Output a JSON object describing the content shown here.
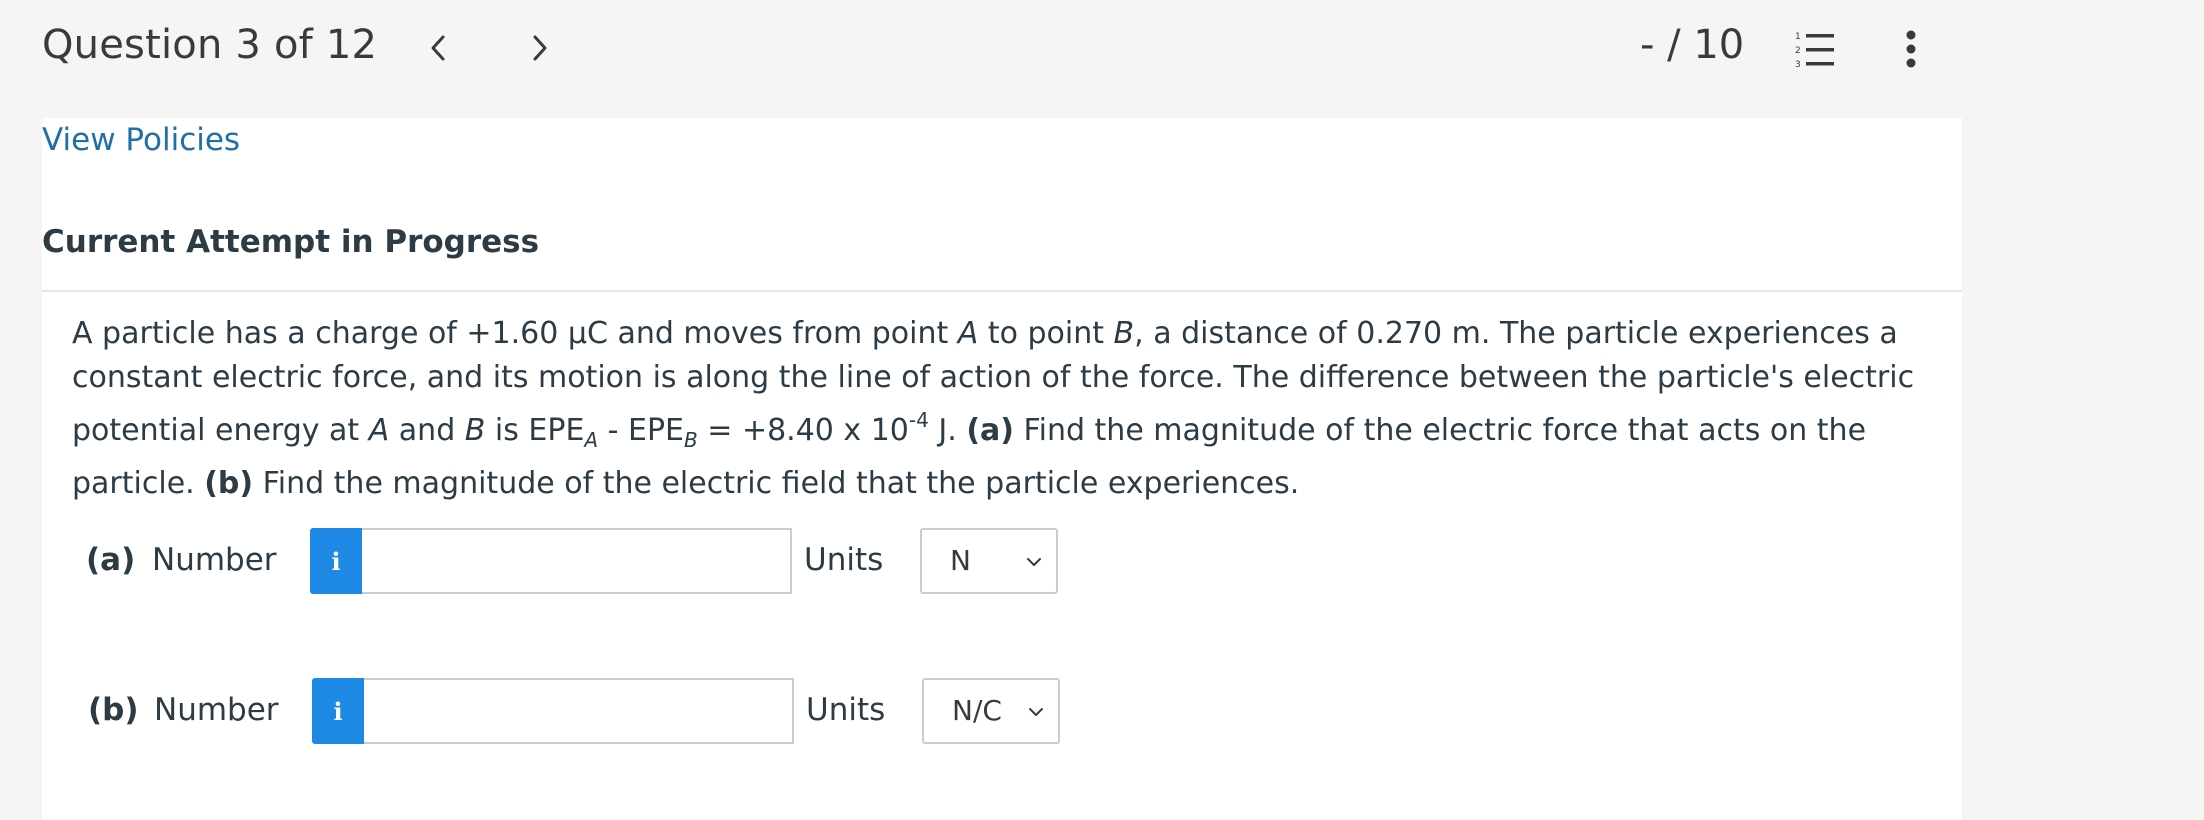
{
  "header": {
    "question_label": "Question 3 of 12",
    "score": "- / 10"
  },
  "policies_link": "View Policies",
  "attempt_heading": "Current Attempt in Progress",
  "question": {
    "text_1": "A particle has a charge of +1.60 μC and moves from point ",
    "point_a": "A",
    "text_2": " to point ",
    "point_b": "B",
    "text_3": ", a distance of 0.270 m. The particle experiences a constant electric force, and its motion is along the line of action of the force. The difference between the particle's electric potential energy at ",
    "point_a2": "A",
    "text_4": " and ",
    "point_b2": "B",
    "text_5": " is EPE",
    "sub_a": "A",
    "text_6": " - EPE",
    "sub_b": "B",
    "text_7": " = +8.40 x 10",
    "exponent": "-4",
    "text_8": " J. ",
    "part_a_bold": "(a)",
    "text_9": " Find the magnitude of the electric force that acts on the particle. ",
    "part_b_bold": "(b)",
    "text_10": " Find the magnitude of the electric field that the particle experiences."
  },
  "answers": [
    {
      "part": "(a)",
      "number_label": "Number",
      "info_icon": "i",
      "value": "",
      "units_label": "Units",
      "unit": "N"
    },
    {
      "part": "(b)",
      "number_label": "Number",
      "info_icon": "i",
      "value": "",
      "units_label": "Units",
      "unit": "N/C"
    }
  ],
  "icons": {
    "prev": "chevron-left-icon",
    "next": "chevron-right-icon",
    "list": "numbered-list-icon",
    "more": "more-vertical-icon",
    "info": "info-icon",
    "dropdown": "chevron-down-icon"
  },
  "colors": {
    "link": "#1f6fa8",
    "info_button": "#1e88e5",
    "page_bg": "#f5f5f5",
    "card_bg": "#ffffff"
  }
}
